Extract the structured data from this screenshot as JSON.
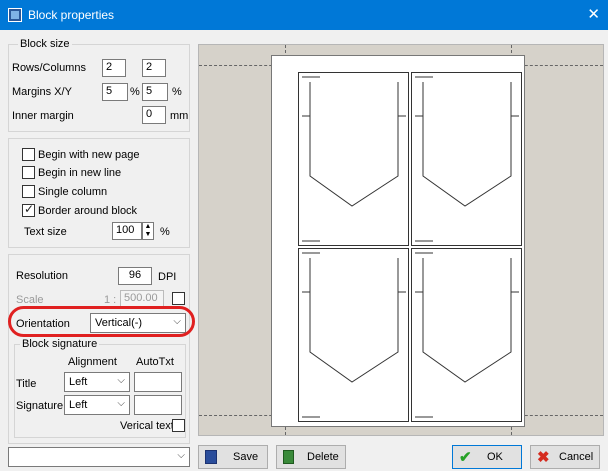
{
  "window": {
    "title": "Block properties",
    "close": "✕"
  },
  "block_size": {
    "legend": "Block size",
    "rows_cols_label": "Rows/Columns",
    "rows": "2",
    "cols": "2",
    "margins_label": "Margins X/Y",
    "margin_x": "5",
    "margin_x_unit": "%",
    "margin_y": "5",
    "margin_y_unit": "%",
    "inner_margin_label": "Inner margin",
    "inner_margin": "0",
    "inner_margin_unit": "mm"
  },
  "options": {
    "begin_new_page": {
      "label": "Begin with new page",
      "checked": false
    },
    "begin_new_line": {
      "label": "Begin in new line",
      "checked": false
    },
    "single_column": {
      "label": "Single column",
      "checked": false
    },
    "border_around": {
      "label": "Border around block",
      "checked": true
    },
    "text_size_label": "Text size",
    "text_size": "100",
    "text_size_unit": "%"
  },
  "render": {
    "resolution_label": "Resolution",
    "resolution": "96",
    "resolution_unit": "DPI",
    "scale_label": "Scale",
    "scale_prefix": "1 :",
    "scale_value": "500.00",
    "orientation_label": "Orientation",
    "orientation_value": "Vertical(-)"
  },
  "signature": {
    "legend": "Block signature",
    "alignment_header": "Alignment",
    "autotxt_header": "AutoTxt",
    "title_label": "Title",
    "title_align": "Left",
    "signature_label": "Signature",
    "signature_align": "Left",
    "vertical_text_label": "Verical text"
  },
  "footer": {
    "save": "Save",
    "delete": "Delete",
    "ok": "OK",
    "cancel": "Cancel"
  },
  "colors": {
    "titlebar": "#0078d7",
    "highlight": "#e02020",
    "preview_bg": "#d6d2ca"
  }
}
